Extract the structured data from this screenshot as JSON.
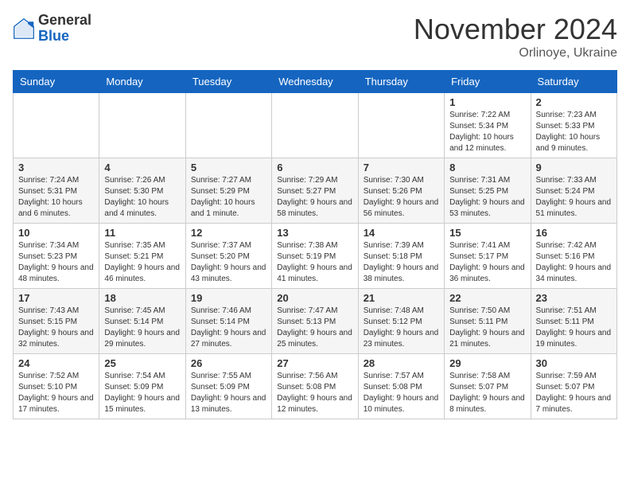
{
  "header": {
    "logo_general": "General",
    "logo_blue": "Blue",
    "month_title": "November 2024",
    "location": "Orlinoye, Ukraine"
  },
  "weekdays": [
    "Sunday",
    "Monday",
    "Tuesday",
    "Wednesday",
    "Thursday",
    "Friday",
    "Saturday"
  ],
  "weeks": [
    [
      null,
      null,
      null,
      null,
      null,
      {
        "day": "1",
        "sunrise": "Sunrise: 7:22 AM",
        "sunset": "Sunset: 5:34 PM",
        "daylight": "Daylight: 10 hours and 12 minutes."
      },
      {
        "day": "2",
        "sunrise": "Sunrise: 7:23 AM",
        "sunset": "Sunset: 5:33 PM",
        "daylight": "Daylight: 10 hours and 9 minutes."
      }
    ],
    [
      {
        "day": "3",
        "sunrise": "Sunrise: 7:24 AM",
        "sunset": "Sunset: 5:31 PM",
        "daylight": "Daylight: 10 hours and 6 minutes."
      },
      {
        "day": "4",
        "sunrise": "Sunrise: 7:26 AM",
        "sunset": "Sunset: 5:30 PM",
        "daylight": "Daylight: 10 hours and 4 minutes."
      },
      {
        "day": "5",
        "sunrise": "Sunrise: 7:27 AM",
        "sunset": "Sunset: 5:29 PM",
        "daylight": "Daylight: 10 hours and 1 minute."
      },
      {
        "day": "6",
        "sunrise": "Sunrise: 7:29 AM",
        "sunset": "Sunset: 5:27 PM",
        "daylight": "Daylight: 9 hours and 58 minutes."
      },
      {
        "day": "7",
        "sunrise": "Sunrise: 7:30 AM",
        "sunset": "Sunset: 5:26 PM",
        "daylight": "Daylight: 9 hours and 56 minutes."
      },
      {
        "day": "8",
        "sunrise": "Sunrise: 7:31 AM",
        "sunset": "Sunset: 5:25 PM",
        "daylight": "Daylight: 9 hours and 53 minutes."
      },
      {
        "day": "9",
        "sunrise": "Sunrise: 7:33 AM",
        "sunset": "Sunset: 5:24 PM",
        "daylight": "Daylight: 9 hours and 51 minutes."
      }
    ],
    [
      {
        "day": "10",
        "sunrise": "Sunrise: 7:34 AM",
        "sunset": "Sunset: 5:23 PM",
        "daylight": "Daylight: 9 hours and 48 minutes."
      },
      {
        "day": "11",
        "sunrise": "Sunrise: 7:35 AM",
        "sunset": "Sunset: 5:21 PM",
        "daylight": "Daylight: 9 hours and 46 minutes."
      },
      {
        "day": "12",
        "sunrise": "Sunrise: 7:37 AM",
        "sunset": "Sunset: 5:20 PM",
        "daylight": "Daylight: 9 hours and 43 minutes."
      },
      {
        "day": "13",
        "sunrise": "Sunrise: 7:38 AM",
        "sunset": "Sunset: 5:19 PM",
        "daylight": "Daylight: 9 hours and 41 minutes."
      },
      {
        "day": "14",
        "sunrise": "Sunrise: 7:39 AM",
        "sunset": "Sunset: 5:18 PM",
        "daylight": "Daylight: 9 hours and 38 minutes."
      },
      {
        "day": "15",
        "sunrise": "Sunrise: 7:41 AM",
        "sunset": "Sunset: 5:17 PM",
        "daylight": "Daylight: 9 hours and 36 minutes."
      },
      {
        "day": "16",
        "sunrise": "Sunrise: 7:42 AM",
        "sunset": "Sunset: 5:16 PM",
        "daylight": "Daylight: 9 hours and 34 minutes."
      }
    ],
    [
      {
        "day": "17",
        "sunrise": "Sunrise: 7:43 AM",
        "sunset": "Sunset: 5:15 PM",
        "daylight": "Daylight: 9 hours and 32 minutes."
      },
      {
        "day": "18",
        "sunrise": "Sunrise: 7:45 AM",
        "sunset": "Sunset: 5:14 PM",
        "daylight": "Daylight: 9 hours and 29 minutes."
      },
      {
        "day": "19",
        "sunrise": "Sunrise: 7:46 AM",
        "sunset": "Sunset: 5:14 PM",
        "daylight": "Daylight: 9 hours and 27 minutes."
      },
      {
        "day": "20",
        "sunrise": "Sunrise: 7:47 AM",
        "sunset": "Sunset: 5:13 PM",
        "daylight": "Daylight: 9 hours and 25 minutes."
      },
      {
        "day": "21",
        "sunrise": "Sunrise: 7:48 AM",
        "sunset": "Sunset: 5:12 PM",
        "daylight": "Daylight: 9 hours and 23 minutes."
      },
      {
        "day": "22",
        "sunrise": "Sunrise: 7:50 AM",
        "sunset": "Sunset: 5:11 PM",
        "daylight": "Daylight: 9 hours and 21 minutes."
      },
      {
        "day": "23",
        "sunrise": "Sunrise: 7:51 AM",
        "sunset": "Sunset: 5:11 PM",
        "daylight": "Daylight: 9 hours and 19 minutes."
      }
    ],
    [
      {
        "day": "24",
        "sunrise": "Sunrise: 7:52 AM",
        "sunset": "Sunset: 5:10 PM",
        "daylight": "Daylight: 9 hours and 17 minutes."
      },
      {
        "day": "25",
        "sunrise": "Sunrise: 7:54 AM",
        "sunset": "Sunset: 5:09 PM",
        "daylight": "Daylight: 9 hours and 15 minutes."
      },
      {
        "day": "26",
        "sunrise": "Sunrise: 7:55 AM",
        "sunset": "Sunset: 5:09 PM",
        "daylight": "Daylight: 9 hours and 13 minutes."
      },
      {
        "day": "27",
        "sunrise": "Sunrise: 7:56 AM",
        "sunset": "Sunset: 5:08 PM",
        "daylight": "Daylight: 9 hours and 12 minutes."
      },
      {
        "day": "28",
        "sunrise": "Sunrise: 7:57 AM",
        "sunset": "Sunset: 5:08 PM",
        "daylight": "Daylight: 9 hours and 10 minutes."
      },
      {
        "day": "29",
        "sunrise": "Sunrise: 7:58 AM",
        "sunset": "Sunset: 5:07 PM",
        "daylight": "Daylight: 9 hours and 8 minutes."
      },
      {
        "day": "30",
        "sunrise": "Sunrise: 7:59 AM",
        "sunset": "Sunset: 5:07 PM",
        "daylight": "Daylight: 9 hours and 7 minutes."
      }
    ]
  ]
}
